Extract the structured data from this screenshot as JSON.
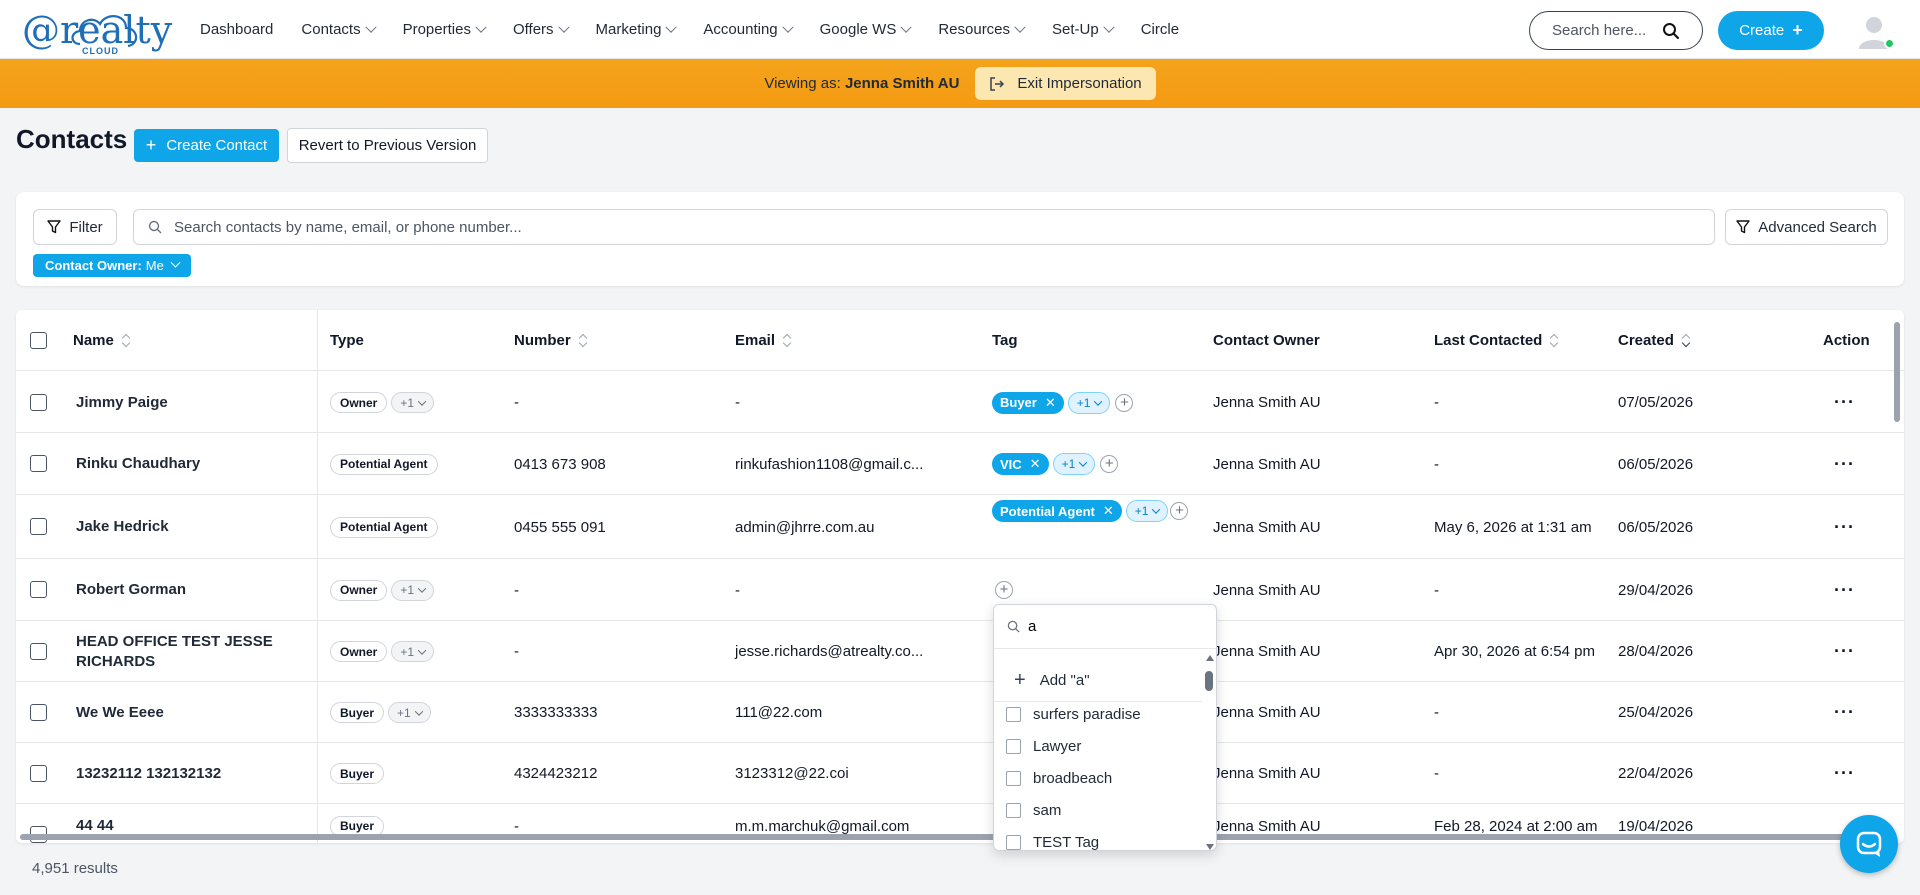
{
  "brand": {
    "logo_at": "@realty",
    "logo_sub": "CLOUD",
    "accent": "#0ea5e9",
    "banner": "#f5a31c"
  },
  "nav": {
    "items": [
      {
        "label": "Dashboard",
        "dropdown": false
      },
      {
        "label": "Contacts",
        "dropdown": true
      },
      {
        "label": "Properties",
        "dropdown": true
      },
      {
        "label": "Offers",
        "dropdown": true
      },
      {
        "label": "Marketing",
        "dropdown": true
      },
      {
        "label": "Accounting",
        "dropdown": true
      },
      {
        "label": "Google WS",
        "dropdown": true
      },
      {
        "label": "Resources",
        "dropdown": true
      },
      {
        "label": "Set-Up",
        "dropdown": true
      },
      {
        "label": "Circle",
        "dropdown": false
      }
    ],
    "search_placeholder": "Search here...",
    "create_label": "Create"
  },
  "impersonation": {
    "prefix": "Viewing as:",
    "user": "Jenna Smith AU",
    "exit_label": "Exit Impersonation"
  },
  "page": {
    "title": "Contacts",
    "create_contact": "Create Contact",
    "revert": "Revert to Previous Version"
  },
  "filters": {
    "filter_label": "Filter",
    "search_placeholder": "Search contacts by name, email, or phone number...",
    "advanced_label": "Advanced Search",
    "chip_key": "Contact Owner:",
    "chip_value": "Me"
  },
  "table": {
    "columns": {
      "name": "Name",
      "type": "Type",
      "number": "Number",
      "email": "Email",
      "tag": "Tag",
      "owner": "Contact Owner",
      "last": "Last Contacted",
      "created": "Created",
      "action": "Action"
    },
    "rows": [
      {
        "name": "Jimmy Paige",
        "type": "Owner",
        "type_more": "+1",
        "number": "-",
        "email": "-",
        "tag": "Buyer",
        "tag_more": "+1",
        "owner": "Jenna Smith AU",
        "last": "-",
        "created": "07/05/2026"
      },
      {
        "name": "Rinku Chaudhary",
        "type": "Potential Agent",
        "type_more": "",
        "number": "0413 673 908",
        "email": "rinkufashion1108@gmail.c...",
        "tag": "VIC",
        "tag_more": "+1",
        "owner": "Jenna Smith AU",
        "last": "-",
        "created": "06/05/2026"
      },
      {
        "name": "Jake Hedrick",
        "type": "Potential Agent",
        "type_more": "",
        "number": "0455 555 091",
        "email": "admin@jhrre.com.au",
        "tag": "Potential Agent",
        "tag_more": "+1",
        "owner": "Jenna Smith AU",
        "last": "May 6, 2026 at 1:31 am",
        "created": "06/05/2026"
      },
      {
        "name": "Robert Gorman",
        "type": "Owner",
        "type_more": "+1",
        "number": "-",
        "email": "-",
        "tag": "",
        "tag_more": "",
        "owner": "Jenna Smith AU",
        "last": "-",
        "created": "29/04/2026"
      },
      {
        "name": "HEAD OFFICE TEST JESSE RICHARDS",
        "type": "Owner",
        "type_more": "+1",
        "number": "-",
        "email": "jesse.richards@atrealty.co...",
        "tag": "",
        "tag_more": "",
        "owner": "Jenna Smith AU",
        "last": "Apr 30, 2026 at 6:54 pm",
        "created": "28/04/2026"
      },
      {
        "name": "We We Eeee",
        "type": "Buyer",
        "type_more": "+1",
        "number": "3333333333",
        "email": "111@22.com",
        "tag": "",
        "tag_more": "",
        "owner": "Jenna Smith AU",
        "last": "-",
        "created": "25/04/2026"
      },
      {
        "name": "13232112 132132132",
        "type": "Buyer",
        "type_more": "",
        "number": "4324423212",
        "email": "3123312@22.coi",
        "tag": "",
        "tag_more": "",
        "owner": "Jenna Smith AU",
        "last": "-",
        "created": "22/04/2026"
      },
      {
        "name": "44 44",
        "type": "Buyer",
        "type_more": "",
        "number": "-",
        "email": "m.m.marchuk@gmail.com",
        "tag": "",
        "tag_more": "",
        "owner": "Jenna Smith AU",
        "last": "Feb 28, 2024 at 2:00 am",
        "created": "19/04/2026"
      }
    ]
  },
  "tag_dropdown": {
    "query": "a",
    "add_label": "Add \"a\"",
    "options": [
      "surfers paradise",
      "Lawyer",
      "broadbeach",
      "sam",
      "TEST Tag"
    ]
  },
  "footer": {
    "results": "4,951 results"
  }
}
